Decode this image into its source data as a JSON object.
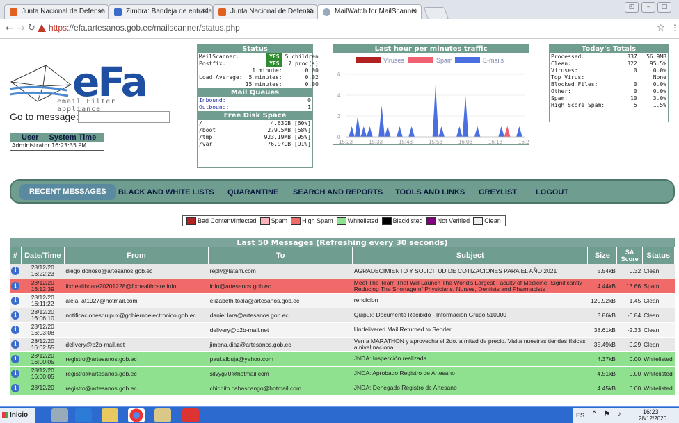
{
  "browser": {
    "tabs": [
      {
        "label": "Junta Nacional de Defensa",
        "color": "#e06020"
      },
      {
        "label": "Zimbra: Bandeja de entrada",
        "color": "#3b6cc9"
      },
      {
        "label": "Junta Nacional de Defensa",
        "color": "#e06020"
      },
      {
        "label": "MailWatch for MailScanner",
        "color": "#9ab"
      }
    ],
    "url_scheme": "https",
    "url_rest": "://efa.artesanos.gob.ec/mailscanner/status.php",
    "star": "☆"
  },
  "logo": {
    "text": "eFa",
    "subtitle": "email Filter appliance"
  },
  "goto_label": "Go to message:",
  "user_box": {
    "col1": "User",
    "col2": "System Time",
    "value": "Administrator 16:23:35 PM"
  },
  "status": {
    "title": "Status",
    "mailscanner_label": "MailScanner:",
    "mailscanner_state": "YES",
    "mailscanner_info": "5 children",
    "postfix_label": "Postfix:",
    "postfix_state": "YES",
    "postfix_info": "7 proc(s)",
    "load_label": "Load Average:",
    "load": [
      {
        "label": "1 minute:",
        "value": "0.00"
      },
      {
        "label": "5 minutes:",
        "value": "0.02"
      },
      {
        "label": "15 minutes:",
        "value": "0.00"
      }
    ],
    "queues_title": "Mail Queues",
    "inbound_label": "Inbound:",
    "inbound": "0",
    "outbound_label": "Outbound:",
    "outbound": "1",
    "disk_title": "Free Disk Space",
    "disk": [
      {
        "mount": "/",
        "free": "4.63GB [60%]"
      },
      {
        "mount": "/boot",
        "free": "279.5MB [58%]"
      },
      {
        "mount": "/tmp",
        "free": "923.19MB [95%]"
      },
      {
        "mount": "/var",
        "free": "76.97GB [91%]"
      }
    ]
  },
  "chart_data": {
    "type": "area",
    "title": "Last hour per minutes traffic",
    "legend": [
      "Viruses",
      "Spam",
      "E-mails"
    ],
    "colors": {
      "Viruses": "#b22222",
      "Spam": "#f06070",
      "E-mails": "#4a6fe0"
    },
    "legend_position": "top",
    "x_ticks": [
      "15:23",
      "15:33",
      "15:43",
      "15:53",
      "16:03",
      "16:13",
      "16:23"
    ],
    "ylim": [
      0,
      6
    ],
    "y_ticks": [
      0,
      2,
      4,
      6
    ],
    "x": [
      "15:23",
      "15:24",
      "15:25",
      "15:26",
      "15:27",
      "15:28",
      "15:29",
      "15:30",
      "15:31",
      "15:32",
      "15:33",
      "15:34",
      "15:35",
      "15:36",
      "15:37",
      "15:38",
      "15:39",
      "15:40",
      "15:41",
      "15:42",
      "15:43",
      "15:44",
      "15:45",
      "15:46",
      "15:47",
      "15:48",
      "15:49",
      "15:50",
      "15:51",
      "15:52",
      "15:53",
      "15:54",
      "15:55",
      "15:56",
      "15:57",
      "15:58",
      "15:59",
      "16:00",
      "16:01",
      "16:02",
      "16:03",
      "16:04",
      "16:05",
      "16:06",
      "16:07",
      "16:08",
      "16:09",
      "16:10",
      "16:11",
      "16:12",
      "16:13",
      "16:14",
      "16:15",
      "16:16",
      "16:17",
      "16:18",
      "16:19",
      "16:20",
      "16:21",
      "16:22",
      "16:23"
    ],
    "series": [
      {
        "name": "E-mails",
        "values": [
          0,
          0,
          1,
          0,
          2,
          0,
          1,
          0,
          1,
          0,
          0,
          0,
          3,
          0,
          1,
          0,
          0,
          0,
          1,
          0,
          0,
          0,
          1,
          0,
          0,
          0,
          0,
          0,
          0,
          0,
          5,
          0,
          1,
          0,
          0,
          0,
          0,
          0,
          1,
          0,
          4,
          0,
          0,
          0,
          1,
          0,
          0,
          0,
          0,
          0,
          0,
          0,
          1,
          0,
          1,
          0,
          0,
          0,
          1,
          0,
          0
        ]
      },
      {
        "name": "Spam",
        "values": [
          0,
          0,
          0,
          0,
          0,
          0,
          0,
          0,
          0,
          0,
          0,
          0,
          0,
          0,
          0,
          0,
          0,
          0,
          0,
          0,
          0,
          0,
          0,
          0,
          0,
          0,
          0,
          0,
          0,
          0,
          0,
          0,
          0,
          0,
          0,
          0,
          0,
          0,
          0,
          0,
          0,
          0,
          0,
          0,
          0,
          0,
          0,
          0,
          0,
          0,
          0,
          0,
          0,
          0,
          1,
          0,
          0,
          0,
          0,
          0,
          0
        ]
      },
      {
        "name": "Viruses",
        "values": [
          0,
          0,
          0,
          0,
          0,
          0,
          0,
          0,
          0,
          0,
          0,
          0,
          0,
          0,
          0,
          0,
          0,
          0,
          0,
          0,
          0,
          0,
          0,
          0,
          0,
          0,
          0,
          0,
          0,
          0,
          0,
          0,
          0,
          0,
          0,
          0,
          0,
          0,
          0,
          0,
          0,
          0,
          0,
          0,
          0,
          0,
          0,
          0,
          0,
          0,
          0,
          0,
          0,
          0,
          0,
          0,
          0,
          0,
          0,
          0,
          0
        ]
      }
    ]
  },
  "totals": {
    "title": "Today's Totals",
    "rows": [
      {
        "label": "Processed:",
        "count": "337",
        "pct": "56.9MB"
      },
      {
        "label": "Clean:",
        "count": "322",
        "pct": "95.5%"
      },
      {
        "label": "Viruses:",
        "count": "0",
        "pct": "0.0%"
      },
      {
        "label": "Top Virus:",
        "count": "",
        "pct": "None"
      },
      {
        "label": "Blocked Files:",
        "count": "0",
        "pct": "0.0%"
      },
      {
        "label": "Other:",
        "count": "0",
        "pct": "0.0%"
      },
      {
        "label": "Spam:",
        "count": "10",
        "pct": "3.0%"
      },
      {
        "label": "High Score Spam:",
        "count": "5",
        "pct": "1.5%"
      }
    ]
  },
  "nav": [
    "RECENT MESSAGES",
    "BLACK AND WHITE LISTS",
    "QUARANTINE",
    "SEARCH AND REPORTS",
    "TOOLS AND LINKS",
    "GREYLIST",
    "LOGOUT"
  ],
  "legend": [
    {
      "label": "Bad Content/Infected",
      "color": "#b22222"
    },
    {
      "label": "Spam",
      "color": "#f8b4b8"
    },
    {
      "label": "High Spam",
      "color": "#f06a6a"
    },
    {
      "label": "Whitelisted",
      "color": "#8fe08f"
    },
    {
      "label": "Blacklisted",
      "color": "#000000"
    },
    {
      "label": "Not Verified",
      "color": "#800080"
    },
    {
      "label": "Clean",
      "color": "#eeeeee"
    }
  ],
  "messages": {
    "title": "Last 50 Messages (Refreshing every 30 seconds)",
    "headers": [
      "#",
      "Date/Time",
      "From",
      "To",
      "Subject",
      "Size",
      "SA Score",
      "Status"
    ],
    "rows": [
      {
        "date": "28/12/20",
        "time": "16:22:23",
        "from": "diego.donoso@artesanos.gob.ec",
        "to": "reply@latam.com",
        "subject": "AGRADECIMIENTO Y SOLICITUD DE COTIZACIONES PARA EL AÑO 2021",
        "size": "5.54kB",
        "score": "0.32",
        "status": "Clean",
        "bg": "#e8e8e8"
      },
      {
        "date": "28/12/20",
        "time": "16:12:39",
        "from": "fixhealthcare20201228@fixhealthcare.info",
        "to": "info@artesanos.gob.ec",
        "subject": "Meet The Team That Will Launch The World's Largest Faculty of Medicine, Significantly Reducing The Shortage of Physicians, Nurses, Dentists and Pharmacists",
        "size": "4.44kB",
        "score": "13.66",
        "status": "Spam",
        "bg": "#f06a6a"
      },
      {
        "date": "28/12/20",
        "time": "16:11:22",
        "from": "aleja_at1927@hotmail.com",
        "to": "elizabeth.toala@artesanos.gob.ec",
        "subject": "rendicion",
        "size": "120.92kB",
        "score": "1.45",
        "status": "Clean",
        "bg": "#f4f4f4"
      },
      {
        "date": "28/12/20",
        "time": "16:06:10",
        "from": "notificacionesquipux@gobiernoelectronico.gob.ec",
        "to": "daniel.lara@artesanos.gob.ec",
        "subject": "Quipux: Documento Recibido - Información Grupo 510000",
        "size": "3.86kB",
        "score": "-0.84",
        "status": "Clean",
        "bg": "#e8e8e8"
      },
      {
        "date": "28/12/20",
        "time": "16:03:08",
        "from": "",
        "to": "delivery@b2b-mail.net",
        "subject": "Undelivered Mail Returned to Sender",
        "size": "38.61kB",
        "score": "-2.33",
        "status": "Clean",
        "bg": "#f4f4f4"
      },
      {
        "date": "28/12/20",
        "time": "16:02:55",
        "from": "delivery@b2b-mail.net",
        "to": "jimena.diaz@artesanos.gob.ec",
        "subject": "Ven a MARATHON y aprovecha el 2do. a mitad de precio. Visita nuestras tiendas físicas a nivel nacional",
        "size": "35.49kB",
        "score": "-0.29",
        "status": "Clean",
        "bg": "#e8e8e8"
      },
      {
        "date": "28/12/20",
        "time": "16:00:05",
        "from": "registro@artesanos.gob.ec",
        "to": "paul.albuja@yahoo.com",
        "subject": "JNDA: Inspección realizada",
        "size": "4.37kB",
        "score": "0.00",
        "status": "Whitelisted",
        "bg": "#8fe08f"
      },
      {
        "date": "28/12/20",
        "time": "16:00:05",
        "from": "registro@artesanos.gob.ec",
        "to": "silvyg70@hotmail.com",
        "subject": "JNDA: Aprobado Registro de Artesano",
        "size": "4.51kB",
        "score": "0.00",
        "status": "Whitelisted",
        "bg": "#8fe08f"
      },
      {
        "date": "28/12/20",
        "time": "",
        "from": "registro@artesanos.gob.ec",
        "to": "chichito.cabascango@hotmail.com",
        "subject": "JNDA: Denegado Registro de Artesano",
        "size": "4.45kB",
        "score": "0.00",
        "status": "Whitelisted",
        "bg": "#8fe08f"
      }
    ]
  },
  "taskbar": {
    "start": "Inicio",
    "lang": "ES",
    "time": "16:23",
    "date": "28/12/2020"
  }
}
